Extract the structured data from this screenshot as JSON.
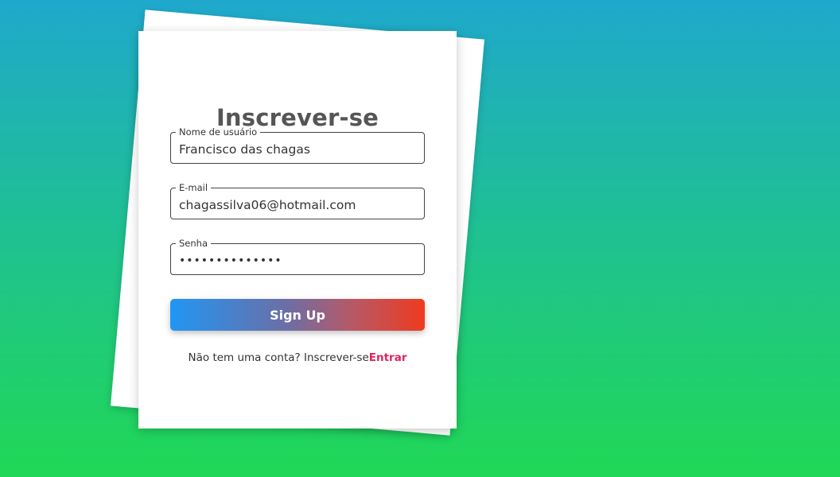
{
  "form": {
    "title": "Inscrever-se",
    "fields": {
      "username": {
        "label": "Nome de usuário",
        "value": "Francisco das chagas"
      },
      "email": {
        "label": "E-mail",
        "value": "chagassilva06@hotmail.com"
      },
      "password": {
        "label": "Senha",
        "value": "••••••••••••••"
      }
    },
    "submit_label": "Sign Up",
    "footer_text": "Não tem uma conta? Inscrever-se",
    "footer_link": "Entrar"
  },
  "colors": {
    "background_top": "#1fa8cc",
    "background_bottom": "#20d855",
    "button_gradient_start": "#2196f3",
    "button_gradient_end": "#ee3b1f",
    "link": "#e0245e",
    "title": "#555555"
  }
}
